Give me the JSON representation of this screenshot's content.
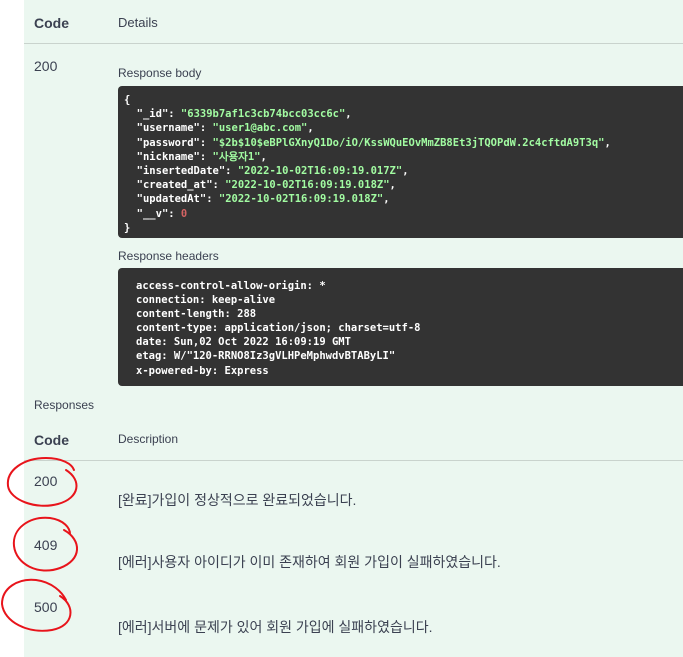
{
  "table_header": {
    "code": "Code",
    "details": "Details"
  },
  "status": "200",
  "response_body_label": "Response body",
  "response_body": {
    "_id": "6339b7af1c3cb74bcc03cc6c",
    "username": "user1@abc.com",
    "password": "$2b$10$eBPlGXnyQ1Do/iO/KssWQuEOvMmZB8Et3jTQOPdW.2c4cftdA9T3q",
    "nickname": "사용자1",
    "insertedDate": "2022-10-02T16:09:19.017Z",
    "created_at": "2022-10-02T16:09:19.018Z",
    "updatedAt": "2022-10-02T16:09:19.018Z",
    "__v": "0"
  },
  "response_headers_label": "Response headers",
  "response_headers": [
    "access-control-allow-origin: *",
    "connection: keep-alive",
    "content-length: 288",
    "content-type: application/json; charset=utf-8",
    "date: Sun,02 Oct 2022 16:09:19 GMT",
    "etag: W/\"120-RRNO8Iz3gVLHPeMphwdvBTAByLI\"",
    "x-powered-by: Express"
  ],
  "responses_label": "Responses",
  "responses_header": {
    "code": "Code",
    "description": "Description"
  },
  "responses": [
    {
      "code": "200",
      "description": "[완료]가입이 정상적으로 완료되었습니다."
    },
    {
      "code": "409",
      "description": "[에러]사용자 아이디가 이미 존재하여 회원 가입이 실패하였습니다."
    },
    {
      "code": "500",
      "description": "[에러]서버에 문제가 있어 회원 가입에 실패하였습니다."
    }
  ],
  "colors": {
    "panel": "#ebf7f0",
    "code_bg": "#333333",
    "string": "#a2fca2",
    "number": "#d36363",
    "annotation": "#e8141b"
  }
}
